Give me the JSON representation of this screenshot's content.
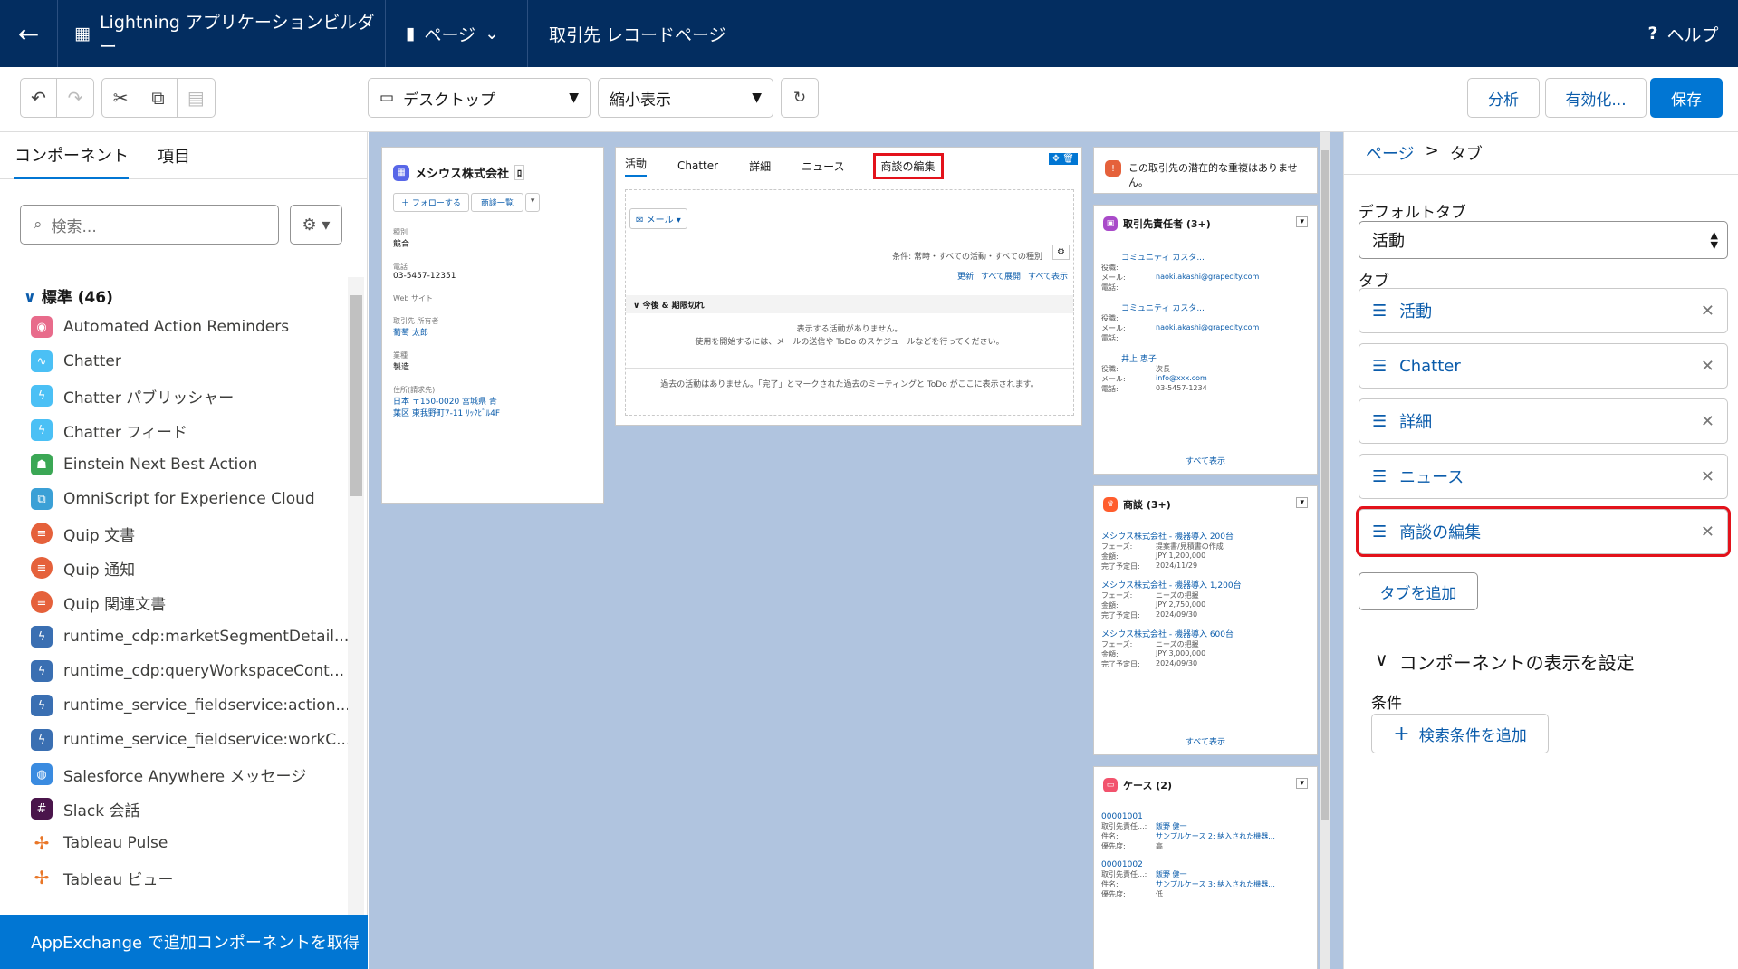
{
  "topbar": {
    "back_icon": "back-arrow-icon",
    "app_title": "Lightning アプリケーションビルダー",
    "page_menu": "ページ",
    "record_title": "取引先 レコードページ",
    "help": "ヘルプ"
  },
  "toolbar": {
    "device": "デスクトップ",
    "zoom": "縮小表示",
    "analyze": "分析",
    "activate": "有効化...",
    "save": "保存"
  },
  "left": {
    "tabs": [
      "コンポーネント",
      "項目"
    ],
    "search_placeholder": "検索...",
    "section": "標準 (46)",
    "components": [
      {
        "label": "Automated Action Reminders",
        "color": "#e86b8b"
      },
      {
        "label": "Chatter",
        "color": "#4bc0f5"
      },
      {
        "label": "Chatter パブリッシャー",
        "color": "#4bc0f5"
      },
      {
        "label": "Chatter フィード",
        "color": "#4bc0f5"
      },
      {
        "label": "Einstein Next Best Action",
        "color": "#3ba755"
      },
      {
        "label": "OmniScript for Experience Cloud",
        "color": "#3ba0d6"
      },
      {
        "label": "Quip 文書",
        "color": "#e5613b"
      },
      {
        "label": "Quip 通知",
        "color": "#e5613b"
      },
      {
        "label": "Quip 関連文書",
        "color": "#e5613b"
      },
      {
        "label": "runtime_cdp:marketSegmentDetail...",
        "color": "#3a6fb2"
      },
      {
        "label": "runtime_cdp:queryWorkspaceCont...",
        "color": "#3a6fb2"
      },
      {
        "label": "runtime_service_fieldservice:action...",
        "color": "#3a6fb2"
      },
      {
        "label": "runtime_service_fieldservice:workC...",
        "color": "#3a6fb2"
      },
      {
        "label": "Salesforce Anywhere メッセージ",
        "color": "#3a8be0"
      },
      {
        "label": "Slack 会話",
        "color": "#4a154b"
      },
      {
        "label": "Tableau Pulse",
        "color": "#e97627"
      },
      {
        "label": "Tableau ビュー",
        "color": "#e97627"
      }
    ],
    "appexchange": "AppExchange で追加コンポーネントを取得"
  },
  "canvas": {
    "account": {
      "name": "メシウス株式会社",
      "follow": "＋ フォローする",
      "deals": "商談一覧",
      "fields": [
        {
          "label": "種別",
          "value": "競合"
        },
        {
          "label": "電話",
          "value": "03-5457-12351"
        },
        {
          "label": "Web サイト",
          "value": ""
        },
        {
          "label": "取引先 所有者",
          "value": "葡萄 太郎"
        },
        {
          "label": "業種",
          "value": "製造"
        },
        {
          "label": "住所(請求先)",
          "value": "日本 〒150-0020 宮城県 青葉区 東我野町7-11 ﾘｯｸﾋﾞﾙ4F"
        }
      ]
    },
    "tabs": [
      "活動",
      "Chatter",
      "詳細",
      "ニュース",
      "商談の編集"
    ],
    "activity": {
      "email": "メール",
      "filter": "条件: 常時・すべての活動・すべての種別",
      "links": [
        "更新",
        "すべて展開",
        "すべて表示"
      ],
      "upcoming": "今後 & 期限切れ",
      "empty": "表示する活動がありません。",
      "empty2": "使用を開始するには、メールの送信や ToDo のスケジュールなどを行ってください。",
      "past": "過去の活動はありません。「完了」とマークされた過去のミーティングと ToDo がここに表示されます。"
    },
    "dup": "この取引先の潜在的な重複はありません。",
    "contacts": {
      "title": "取引先責任者 (3+)",
      "items": [
        {
          "name": "コミュニティ カスタ...",
          "title": "",
          "email": "naoki.akashi@grapecity.com",
          "phone": ""
        },
        {
          "name": "コミュニティ カスタ...",
          "title": "",
          "email": "naoki.akashi@grapecity.com",
          "phone": ""
        },
        {
          "name": "井上 恵子",
          "title": "次長",
          "email": "info@xxx.com",
          "phone": "03-5457-1234"
        }
      ],
      "more": "すべて表示"
    },
    "opps": {
      "title": "商談 (3+)",
      "items": [
        {
          "name": "メシウス株式会社 - 機器導入 200台",
          "phase": "提案書/見積書の作成",
          "amount": "JPY 1,200,000",
          "close": "2024/11/29"
        },
        {
          "name": "メシウス株式会社 - 機器導入 1,200台",
          "phase": "ニーズの把握",
          "amount": "JPY 2,750,000",
          "close": "2024/09/30"
        },
        {
          "name": "メシウス株式会社 - 機器導入 600台",
          "phase": "ニーズの把握",
          "amount": "JPY 3,000,000",
          "close": "2024/09/30"
        }
      ],
      "more": "すべて表示"
    },
    "cases": {
      "title": "ケース (2)",
      "items": [
        {
          "no": "00001001",
          "owner": "飯野 健一",
          "subject": "サンプルケース 2: 納入された機器...",
          "priority": "高"
        },
        {
          "no": "00001002",
          "owner": "飯野 健一",
          "subject": "サンプルケース 3: 納入された機器...",
          "priority": "低"
        }
      ]
    }
  },
  "right": {
    "breadcrumb_page": "ページ",
    "breadcrumb_sep": ">",
    "breadcrumb_current": "タブ",
    "default_tab_label": "デフォルトタブ",
    "default_tab_value": "活動",
    "tabs_label": "タブ",
    "tabs": [
      "活動",
      "Chatter",
      "詳細",
      "ニュース",
      "商談の編集"
    ],
    "add_tab": "タブを追加",
    "visibility": "コンポーネントの表示を設定",
    "condition": "条件",
    "add_filter": "検索条件を追加"
  }
}
